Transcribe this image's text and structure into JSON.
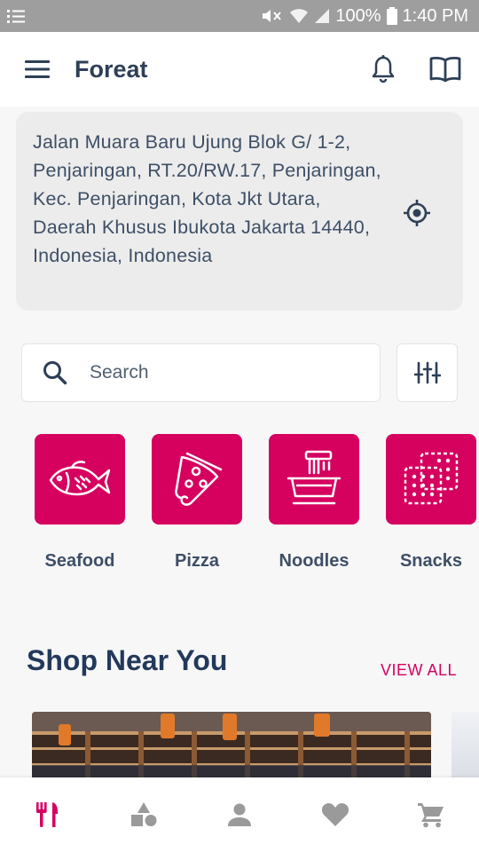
{
  "status_bar": {
    "battery": "100%",
    "time": "1:40 PM"
  },
  "app_bar": {
    "title": "Foreat"
  },
  "address": {
    "text": "Jalan Muara Baru Ujung Blok G/ 1-2, Penjaringan, RT.20/RW.17, Penjaringan, Kec. Penjaringan, Kota Jkt Utara, Daerah Khusus Ibukota Jakarta 14440, Indonesia, Indonesia"
  },
  "search": {
    "placeholder": "Search",
    "value": ""
  },
  "categories": [
    {
      "label": "Seafood",
      "icon": "fish-icon"
    },
    {
      "label": "Pizza",
      "icon": "pizza-icon"
    },
    {
      "label": "Noodles",
      "icon": "noodles-icon"
    },
    {
      "label": "Snacks",
      "icon": "crackers-icon"
    }
  ],
  "shop_section": {
    "title": "Shop Near You",
    "view_all": "VIEW ALL"
  },
  "bottom_nav": [
    {
      "icon": "restaurant-icon",
      "active": true
    },
    {
      "icon": "shapes-icon",
      "active": false
    },
    {
      "icon": "person-icon",
      "active": false
    },
    {
      "icon": "heart-icon",
      "active": false
    },
    {
      "icon": "cart-icon",
      "active": false
    }
  ],
  "colors": {
    "accent": "#d6005f",
    "text_dark": "#2e3f57",
    "icon_inactive": "#9a9a9a"
  }
}
